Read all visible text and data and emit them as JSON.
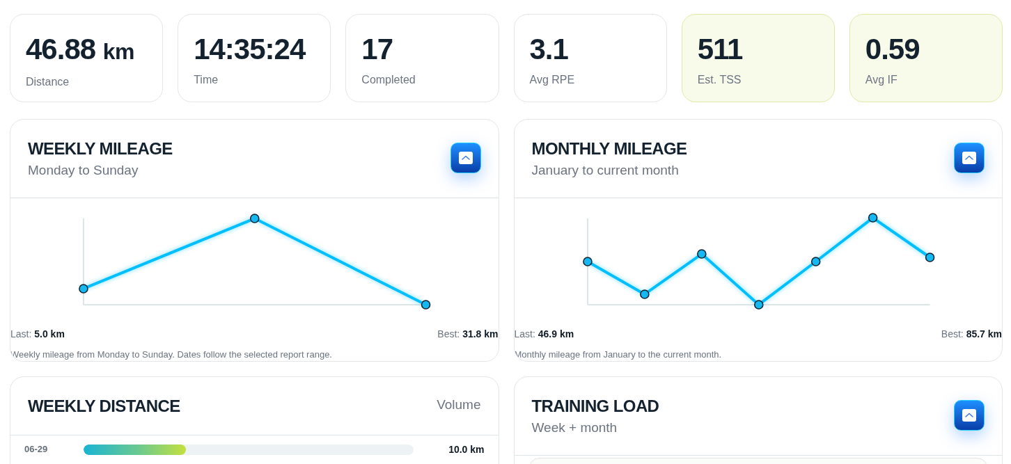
{
  "stats": [
    {
      "value": "46.88",
      "unit": "km",
      "label": "Distance",
      "highlighted": false
    },
    {
      "value": "14:35:24",
      "label": "Time",
      "highlighted": false
    },
    {
      "value": "17",
      "label": "Completed",
      "highlighted": false
    },
    {
      "value": "3.1",
      "label": "Avg RPE",
      "highlighted": false
    },
    {
      "value": "511",
      "label": "Est. TSS",
      "highlighted": true
    },
    {
      "value": "0.59",
      "label": "Avg IF",
      "highlighted": true
    }
  ],
  "mileage_panels": [
    {
      "title": "WEEKLY MILEAGE",
      "subtitle": "Monday to Sunday",
      "last": "Last: **5.0 km**",
      "best": "Best: **31.8 km**",
      "caption": "Weekly mileage from Monday to Sunday. Dates follow the selected report range."
    },
    {
      "title": "MONTHLY MILEAGE",
      "subtitle": "January to current month",
      "last": "Last: **46.9 km**",
      "best": "Best: **85.7 km**",
      "caption": "Monthly mileage from January to the current month."
    }
  ],
  "weekly_distance": {
    "title": "WEEKLY DISTANCE",
    "note": "Volume",
    "rows": [
      {
        "label": "06-29",
        "level": 0.31,
        "value": "10.0 km"
      }
    ]
  },
  "training_load": {
    "title": "TRAINING LOAD",
    "subtitle": "Week + month"
  }
}
